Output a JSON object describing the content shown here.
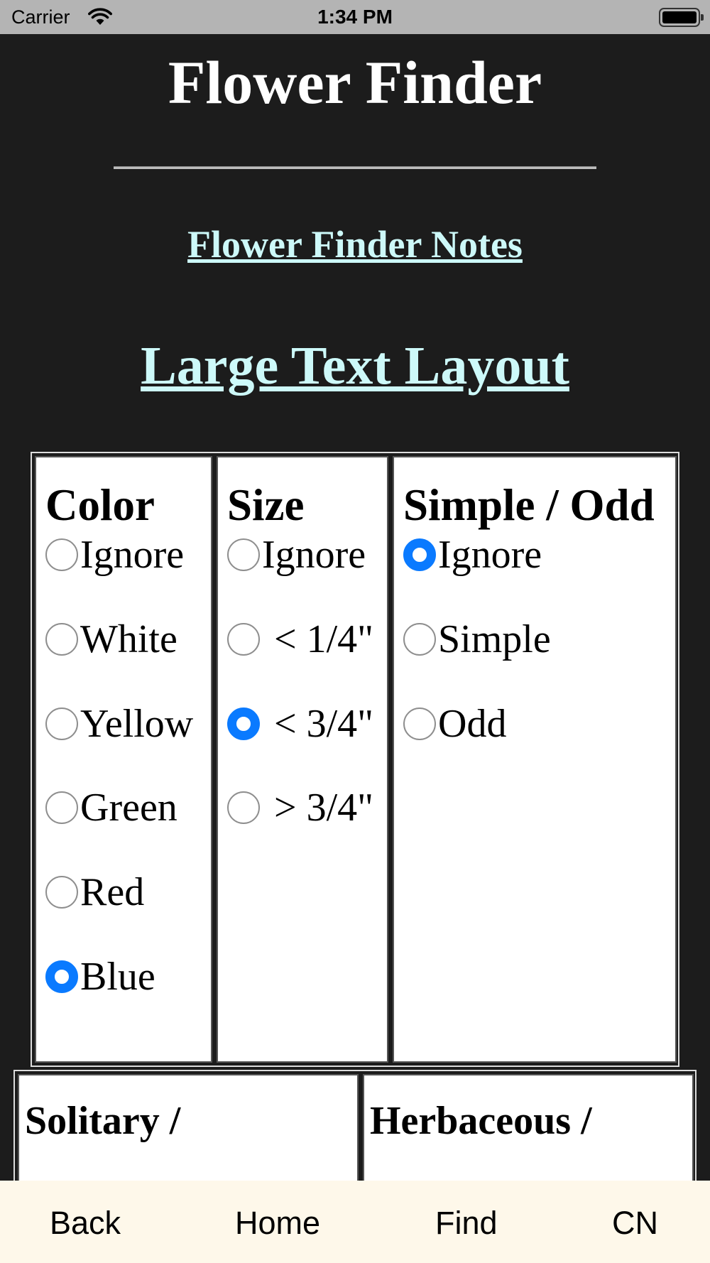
{
  "status_bar": {
    "carrier": "Carrier",
    "time": "1:34 PM"
  },
  "page": {
    "title": "Flower Finder",
    "notes_link": "Flower Finder Notes",
    "large_text_link": "Large Text Layout"
  },
  "filters": {
    "color": {
      "heading": "Color",
      "options": [
        "Ignore",
        "White",
        "Yellow",
        "Green",
        "Red",
        "Blue"
      ],
      "selected": "Blue"
    },
    "size": {
      "heading": "Size",
      "options": [
        "Ignore",
        "< 1/4\"",
        "< 3/4\"",
        "> 3/4\""
      ],
      "selected": "< 3/4\""
    },
    "simple_odd": {
      "heading": "Simple / Odd",
      "options": [
        "Ignore",
        "Simple",
        "Odd"
      ],
      "selected": "Ignore"
    },
    "solitary": {
      "heading": "Solitary /"
    },
    "herbaceous": {
      "heading": "Herbaceous /"
    }
  },
  "bottom_nav": {
    "back": "Back",
    "home": "Home",
    "find": "Find",
    "cn": "CN"
  },
  "colors": {
    "background": "#1c1c1c",
    "link": "#cdf9f9",
    "radio_selected": "#0a7aff",
    "bottom_bar": "#fef8ea"
  }
}
